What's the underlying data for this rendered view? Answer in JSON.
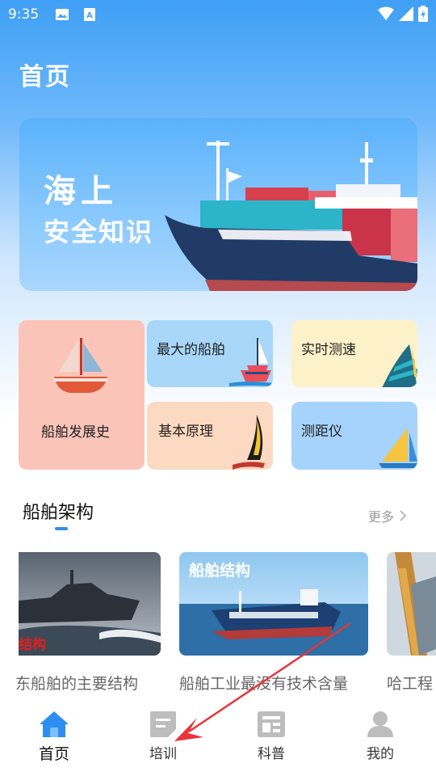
{
  "status_bar": {
    "time": "9:35",
    "icons": [
      "image-icon",
      "a-badge-icon",
      "wifi-icon",
      "signal-icon",
      "battery-icon"
    ]
  },
  "header": {
    "title": "首页"
  },
  "banner": {
    "line1": "海上",
    "line2": "安全知识"
  },
  "categories": [
    {
      "label": "船舶发展史",
      "icon": "sailboat-icon",
      "color": "#fbc4b8"
    },
    {
      "label": "最大的船舶",
      "icon": "ship-sail-icon",
      "color": "#a8d7fa"
    },
    {
      "label": "实时测速",
      "icon": "sail-icon",
      "color": "#fdf1c9"
    },
    {
      "label": "基本原理",
      "icon": "windsurf-icon",
      "color": "#fcd9c1"
    },
    {
      "label": "测距仪",
      "icon": "yacht-sail-icon",
      "color": "#a6d3fb"
    }
  ],
  "section": {
    "title": "船舶架构",
    "more_label": "更多",
    "accent": "#2e8ff0"
  },
  "articles": [
    {
      "title": "东船舶的主要结构",
      "overlay": "结构"
    },
    {
      "title": "船舶工业最没有技术含量",
      "overlay": "船舶结构"
    },
    {
      "title": "哈工程",
      "overlay": ""
    }
  ],
  "bottom_nav": {
    "items": [
      {
        "label": "首页",
        "icon": "home-icon",
        "active": true
      },
      {
        "label": "培训",
        "icon": "training-icon",
        "active": false
      },
      {
        "label": "科普",
        "icon": "science-icon",
        "active": false
      },
      {
        "label": "我的",
        "icon": "profile-icon",
        "active": false
      }
    ],
    "active_color": "#2d8ef2",
    "inactive_color": "#bdbdbd"
  }
}
